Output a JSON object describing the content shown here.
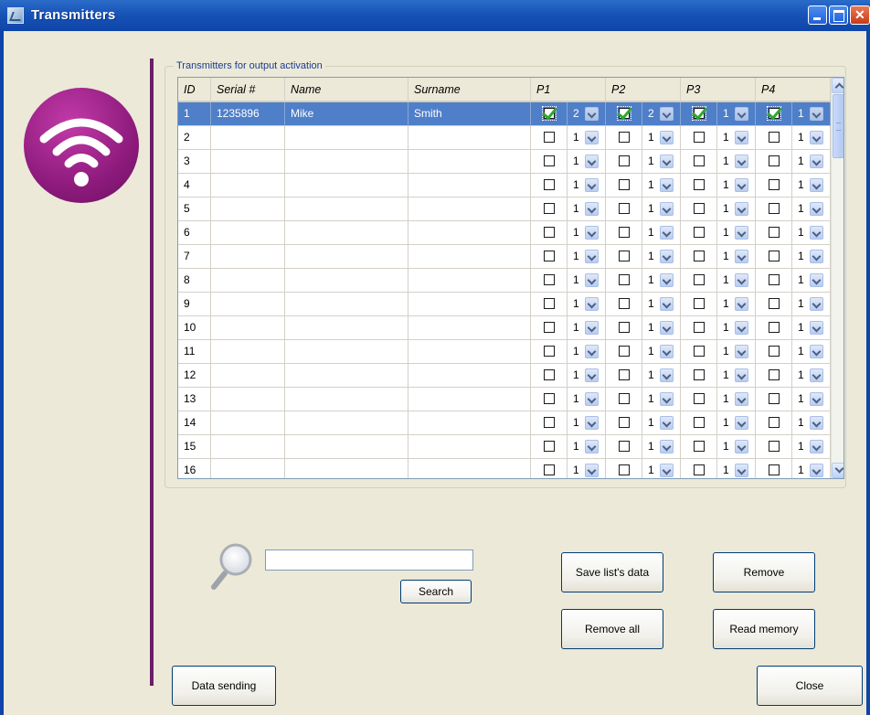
{
  "window": {
    "title": "Transmitters"
  },
  "group": {
    "label": "Transmitters for output activation"
  },
  "table": {
    "columns": {
      "id": "ID",
      "serial": "Serial #",
      "name": "Name",
      "surname": "Surname",
      "p1": "P1",
      "p2": "P2",
      "p3": "P3",
      "p4": "P4"
    },
    "rows": [
      {
        "id": "1",
        "serial": "1235896",
        "name": "Mike",
        "surname": "Smith",
        "selected": true,
        "p": [
          {
            "checked": true,
            "value": "2"
          },
          {
            "checked": true,
            "value": "2"
          },
          {
            "checked": true,
            "value": "1"
          },
          {
            "checked": true,
            "value": "1"
          }
        ]
      },
      {
        "id": "2",
        "serial": "",
        "name": "",
        "surname": "",
        "p": [
          {
            "checked": false,
            "value": "1"
          },
          {
            "checked": false,
            "value": "1"
          },
          {
            "checked": false,
            "value": "1"
          },
          {
            "checked": false,
            "value": "1"
          }
        ]
      },
      {
        "id": "3",
        "serial": "",
        "name": "",
        "surname": "",
        "p": [
          {
            "checked": false,
            "value": "1"
          },
          {
            "checked": false,
            "value": "1"
          },
          {
            "checked": false,
            "value": "1"
          },
          {
            "checked": false,
            "value": "1"
          }
        ]
      },
      {
        "id": "4",
        "serial": "",
        "name": "",
        "surname": "",
        "p": [
          {
            "checked": false,
            "value": "1"
          },
          {
            "checked": false,
            "value": "1"
          },
          {
            "checked": false,
            "value": "1"
          },
          {
            "checked": false,
            "value": "1"
          }
        ]
      },
      {
        "id": "5",
        "serial": "",
        "name": "",
        "surname": "",
        "p": [
          {
            "checked": false,
            "value": "1"
          },
          {
            "checked": false,
            "value": "1"
          },
          {
            "checked": false,
            "value": "1"
          },
          {
            "checked": false,
            "value": "1"
          }
        ]
      },
      {
        "id": "6",
        "serial": "",
        "name": "",
        "surname": "",
        "p": [
          {
            "checked": false,
            "value": "1"
          },
          {
            "checked": false,
            "value": "1"
          },
          {
            "checked": false,
            "value": "1"
          },
          {
            "checked": false,
            "value": "1"
          }
        ]
      },
      {
        "id": "7",
        "serial": "",
        "name": "",
        "surname": "",
        "p": [
          {
            "checked": false,
            "value": "1"
          },
          {
            "checked": false,
            "value": "1"
          },
          {
            "checked": false,
            "value": "1"
          },
          {
            "checked": false,
            "value": "1"
          }
        ]
      },
      {
        "id": "8",
        "serial": "",
        "name": "",
        "surname": "",
        "p": [
          {
            "checked": false,
            "value": "1"
          },
          {
            "checked": false,
            "value": "1"
          },
          {
            "checked": false,
            "value": "1"
          },
          {
            "checked": false,
            "value": "1"
          }
        ]
      },
      {
        "id": "9",
        "serial": "",
        "name": "",
        "surname": "",
        "p": [
          {
            "checked": false,
            "value": "1"
          },
          {
            "checked": false,
            "value": "1"
          },
          {
            "checked": false,
            "value": "1"
          },
          {
            "checked": false,
            "value": "1"
          }
        ]
      },
      {
        "id": "10",
        "serial": "",
        "name": "",
        "surname": "",
        "p": [
          {
            "checked": false,
            "value": "1"
          },
          {
            "checked": false,
            "value": "1"
          },
          {
            "checked": false,
            "value": "1"
          },
          {
            "checked": false,
            "value": "1"
          }
        ]
      },
      {
        "id": "11",
        "serial": "",
        "name": "",
        "surname": "",
        "p": [
          {
            "checked": false,
            "value": "1"
          },
          {
            "checked": false,
            "value": "1"
          },
          {
            "checked": false,
            "value": "1"
          },
          {
            "checked": false,
            "value": "1"
          }
        ]
      },
      {
        "id": "12",
        "serial": "",
        "name": "",
        "surname": "",
        "p": [
          {
            "checked": false,
            "value": "1"
          },
          {
            "checked": false,
            "value": "1"
          },
          {
            "checked": false,
            "value": "1"
          },
          {
            "checked": false,
            "value": "1"
          }
        ]
      },
      {
        "id": "13",
        "serial": "",
        "name": "",
        "surname": "",
        "p": [
          {
            "checked": false,
            "value": "1"
          },
          {
            "checked": false,
            "value": "1"
          },
          {
            "checked": false,
            "value": "1"
          },
          {
            "checked": false,
            "value": "1"
          }
        ]
      },
      {
        "id": "14",
        "serial": "",
        "name": "",
        "surname": "",
        "p": [
          {
            "checked": false,
            "value": "1"
          },
          {
            "checked": false,
            "value": "1"
          },
          {
            "checked": false,
            "value": "1"
          },
          {
            "checked": false,
            "value": "1"
          }
        ]
      },
      {
        "id": "15",
        "serial": "",
        "name": "",
        "surname": "",
        "p": [
          {
            "checked": false,
            "value": "1"
          },
          {
            "checked": false,
            "value": "1"
          },
          {
            "checked": false,
            "value": "1"
          },
          {
            "checked": false,
            "value": "1"
          }
        ]
      },
      {
        "id": "16",
        "serial": "",
        "name": "",
        "surname": "",
        "p": [
          {
            "checked": false,
            "value": "1"
          },
          {
            "checked": false,
            "value": "1"
          },
          {
            "checked": false,
            "value": "1"
          },
          {
            "checked": false,
            "value": "1"
          }
        ]
      }
    ]
  },
  "search": {
    "value": "",
    "button_label": "Search"
  },
  "buttons": {
    "save": "Save list's data",
    "remove": "Remove",
    "remove_all": "Remove all",
    "read_memory": "Read memory",
    "data_sending": "Data sending",
    "close": "Close"
  },
  "colors": {
    "title_bar": "#1853b8",
    "selection": "#4f7fc9",
    "logo": "#8e1b7d",
    "divider": "#6a1f66"
  },
  "icons": {
    "logo": "wifi-icon",
    "search": "magnifier-icon"
  }
}
